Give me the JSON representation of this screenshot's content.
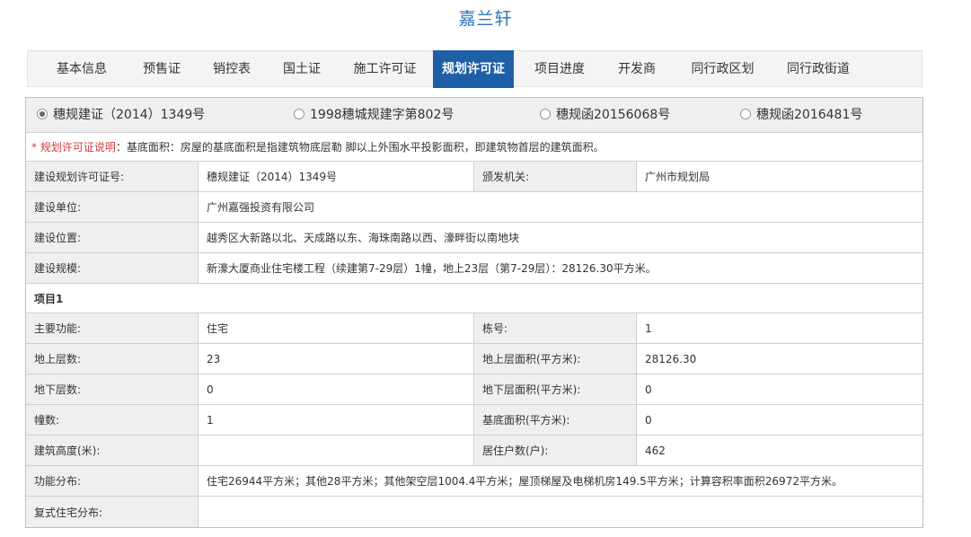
{
  "page": {
    "title": "嘉兰轩"
  },
  "tabs": [
    {
      "label": "基本信息"
    },
    {
      "label": "预售证"
    },
    {
      "label": "销控表"
    },
    {
      "label": "国土证"
    },
    {
      "label": "施工许可证"
    },
    {
      "label": "规划许可证",
      "active": true
    },
    {
      "label": "项目进度"
    },
    {
      "label": "开发商"
    },
    {
      "label": "同行政区划"
    },
    {
      "label": "同行政街道"
    }
  ],
  "permits": [
    {
      "label": "穗规建证（2014）1349号",
      "selected": true
    },
    {
      "label": "1998穗城规建字第802号",
      "selected": false
    },
    {
      "label": "穗规函20156068号",
      "selected": false
    },
    {
      "label": "穗规函2016481号",
      "selected": false
    }
  ],
  "note": {
    "prefix": "* 规划许可证说明",
    "text": "：基底面积：房屋的基底面积是指建筑物底层勒 脚以上外围水平投影面积，即建筑物首层的建筑面积。"
  },
  "info": {
    "permit_no_label": "建设规划许可证号:",
    "permit_no": "穗规建证（2014）1349号",
    "issuer_label": "颁发机关:",
    "issuer": "广州市规划局",
    "builder_label": "建设单位:",
    "builder": "广州嘉强投资有限公司",
    "location_label": "建设位置:",
    "location": "越秀区大新路以北、天成路以东、海珠南路以西、濠畔街以南地块",
    "scale_label": "建设规模:",
    "scale": "新濠大厦商业住宅楼工程（续建第7-29层）1幢，地上23层（第7-29层）：28126.30平方米。"
  },
  "project": {
    "heading": "项目1",
    "function_label": "主要功能:",
    "function": "住宅",
    "building_no_label": "栋号:",
    "building_no": "1",
    "floors_above_label": "地上层数:",
    "floors_above": "23",
    "area_above_label": "地上层面积(平方米):",
    "area_above": "28126.30",
    "floors_below_label": "地下层数:",
    "floors_below": "0",
    "area_below_label": "地下层面积(平方米):",
    "area_below": "0",
    "buildings_label": "幢数:",
    "buildings": "1",
    "base_area_label": "基底面积(平方米):",
    "base_area": "0",
    "height_label": "建筑高度(米):",
    "height": "",
    "households_label": "居住户数(户):",
    "households": "462",
    "distribution_label": "功能分布:",
    "distribution": "住宅26944平方米；其他28平方米；其他架空层1004.4平方米；屋顶梯屋及电梯机房149.5平方米；计算容积率面积26972平方米。",
    "duplex_label": "复式住宅分布:",
    "duplex": ""
  }
}
